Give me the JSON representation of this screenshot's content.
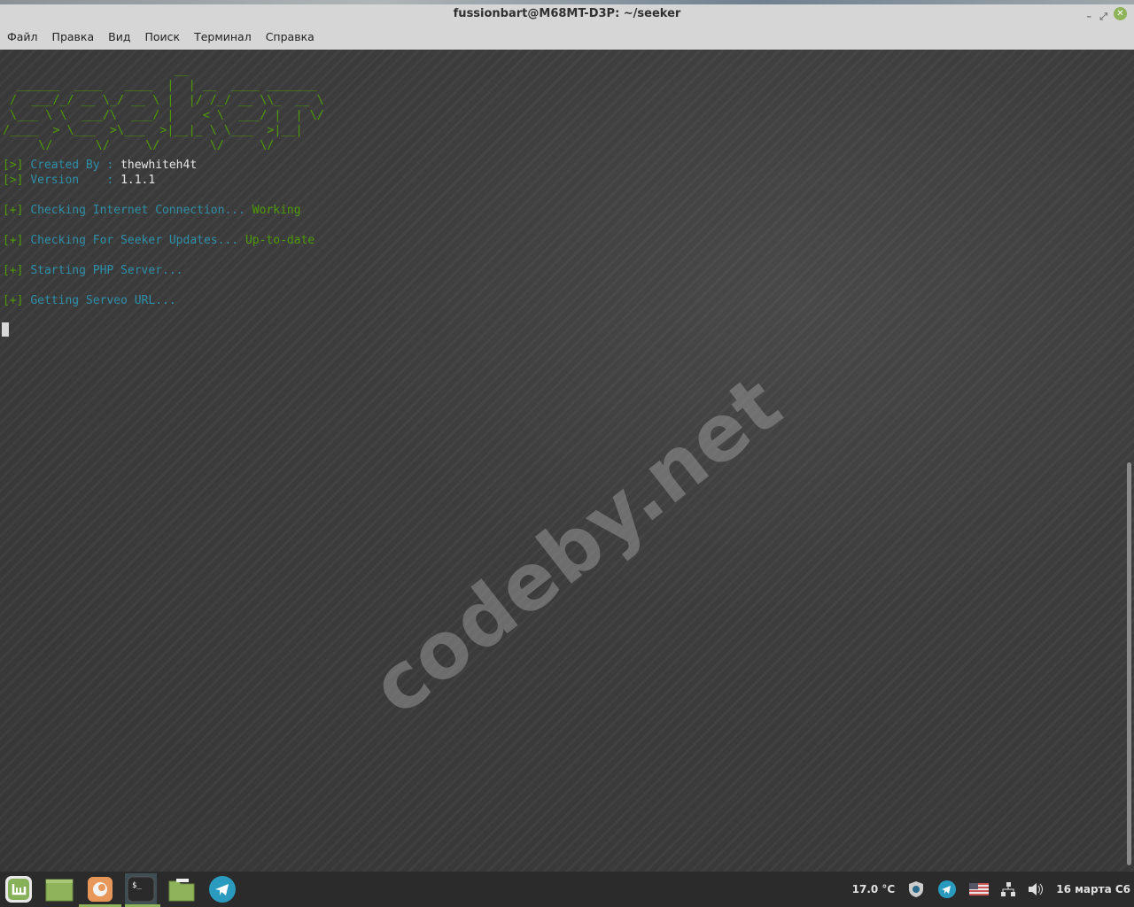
{
  "window": {
    "title": "fussionbart@M68MT-D3P: ~/seeker",
    "minimize": "–",
    "maximize": "⤢",
    "close": "✕"
  },
  "menu": [
    "Файл",
    "Правка",
    "Вид",
    "Поиск",
    "Терминал",
    "Справка"
  ],
  "terminal": {
    "banner": "                        __\n  ______  ____   ____  |  | __  ____ _______\n /  ___/_/ __ \\_/ __ \\ |  |/ /_/ __ \\\\_  __ \\\n \\___ \\ \\  ___/\\  ___/ |    < \\  ___/ |  | \\/\n/____  > \\___  >\\___  >|__|_ \\ \\___  >|__|\n     \\/      \\/     \\/       \\/     \\/",
    "created_prefix": "[>]",
    "created_label": "Created By :",
    "created_value": "thewhiteh4t",
    "version_prefix": "[>]",
    "version_label": "Version    :",
    "version_value": "1.1.1",
    "steps": [
      {
        "prefix": "[+]",
        "text": "Checking Internet Connection...",
        "status": "Working"
      },
      {
        "prefix": "[+]",
        "text": "Checking For Seeker Updates...",
        "status": "Up-to-date"
      },
      {
        "prefix": "[+]",
        "text": "Starting PHP Server...",
        "status": ""
      },
      {
        "prefix": "[+]",
        "text": "Getting Serveo URL...",
        "status": ""
      }
    ]
  },
  "watermark": "codeby.net",
  "taskbar": {
    "apps": [
      "mint-menu",
      "desktop",
      "firefox",
      "terminal",
      "files",
      "telegram"
    ],
    "tray": {
      "temperature": "17.0 °C",
      "clock": "16 марта С6"
    }
  },
  "colors": {
    "green": "#4e9a06",
    "cyan": "#2e8fa8"
  }
}
